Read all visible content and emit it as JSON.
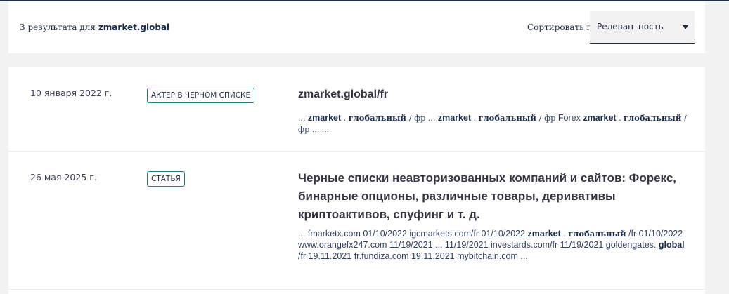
{
  "header": {
    "result_count_prefix": "3 результата для",
    "query": "zmarket.global",
    "sort_label": "Сортировать по :",
    "sort_value": "Релевантность"
  },
  "results": [
    {
      "date": "10 января 2022 г.",
      "badge": "АКТЕР В ЧЕРНОМ СПИСКЕ",
      "title": "zmarket.global/fr",
      "snippet": [
        {
          "t": "... "
        },
        {
          "t": "zmarket",
          "b": true
        },
        {
          "t": " . "
        },
        {
          "t": "глобальный",
          "b": true,
          "serif": true
        },
        {
          "t": " / ",
          "serif": true
        },
        {
          "t": "фр",
          "serif": true
        },
        {
          "t": " ... "
        },
        {
          "t": "zmarket",
          "b": true
        },
        {
          "t": " . "
        },
        {
          "t": "глобальный",
          "b": true,
          "serif": true
        },
        {
          "t": " / ",
          "serif": true
        },
        {
          "t": "фр",
          "serif": true
        },
        {
          "t": " Forex "
        },
        {
          "t": "zmarket",
          "b": true
        },
        {
          "t": " . "
        },
        {
          "t": "глобальный",
          "b": true,
          "serif": true
        },
        {
          "t": " / ",
          "serif": true
        },
        {
          "t": "фр",
          "serif": true
        },
        {
          "t": " ... ..."
        }
      ]
    },
    {
      "date": "26 мая 2025 г.",
      "badge": "СТАТЬЯ",
      "title": "Черные списки неавторизованных компаний и сайтов: Форекс, бинарные опционы, различные товары, деривативы криптоактивов, спуфинг и т. д.",
      "snippet": [
        {
          "t": "... fmarketx.com 01/10/2022 igcmarkets.com/fr 01/10/2022 "
        },
        {
          "t": "zmarket",
          "b": true
        },
        {
          "t": " . "
        },
        {
          "t": "глобальный",
          "b": true,
          "serif": true
        },
        {
          "t": " /fr 01/10/2022 www.orangefx247.com 11/19/2021 ... 11/19/2021 investards.com/fr 11/19/2021 goldengates. "
        },
        {
          "t": "global",
          "b": true
        },
        {
          "t": " /fr 19.11.2021 fr.fundiza.com 19.11.2021 mybitchain.com ..."
        }
      ]
    }
  ]
}
